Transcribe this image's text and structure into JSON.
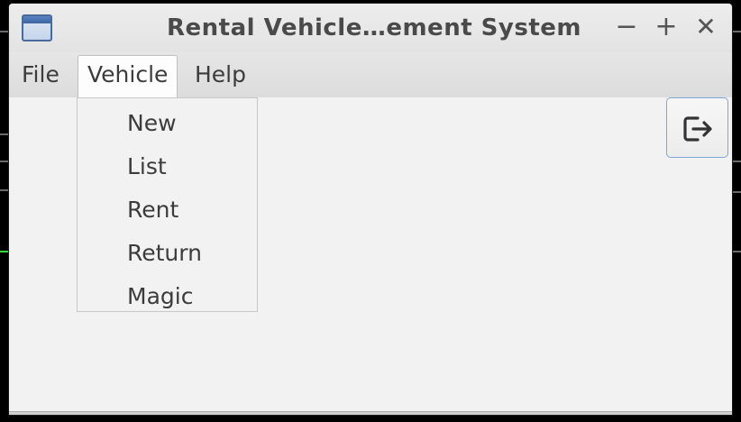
{
  "window": {
    "title": "Rental Vehicle…ement System",
    "minimize_label": "−",
    "maximize_label": "+",
    "close_label": "✕"
  },
  "menubar": {
    "items": [
      {
        "label": "File"
      },
      {
        "label": "Vehicle",
        "open": true
      },
      {
        "label": "Help"
      }
    ]
  },
  "vehicle_menu": {
    "items": [
      {
        "label": "New"
      },
      {
        "label": "List"
      },
      {
        "label": "Rent"
      },
      {
        "label": "Return"
      },
      {
        "label": "Magic"
      }
    ]
  },
  "toolbar": {
    "logout_icon": "logout-icon"
  }
}
